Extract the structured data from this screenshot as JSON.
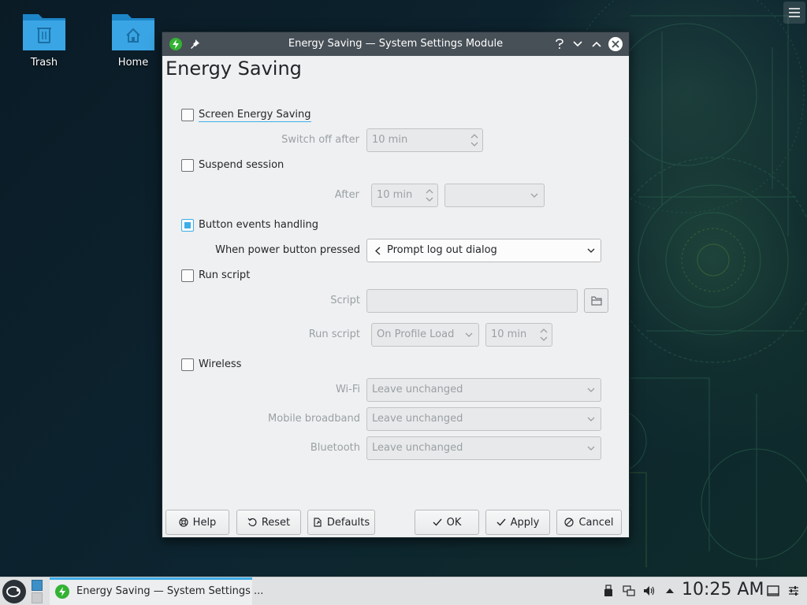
{
  "desktop": {
    "icons": [
      {
        "label": "Trash",
        "icon": "trash-folder-icon"
      },
      {
        "label": "Home",
        "icon": "home-folder-icon"
      }
    ]
  },
  "window": {
    "title": "Energy Saving — System Settings Module",
    "page_title": "Energy Saving",
    "screen_energy": {
      "label": "Screen Energy Saving",
      "checked": false,
      "switch_off_label": "Switch off after",
      "switch_off_value": "10 min"
    },
    "suspend": {
      "label": "Suspend session",
      "checked": false,
      "after_label": "After",
      "after_value": "10 min",
      "action_value": ""
    },
    "button_events": {
      "label": "Button events handling",
      "checked": true,
      "power_label": "When power button pressed",
      "power_value": "Prompt log out dialog"
    },
    "run_script": {
      "label": "Run script",
      "checked": false,
      "script_label": "Script",
      "script_value": "",
      "run_label": "Run script",
      "run_value": "On Profile Load",
      "time_value": "10 min"
    },
    "wireless": {
      "label": "Wireless",
      "checked": false,
      "wifi_label": "Wi-Fi",
      "wifi_value": "Leave unchanged",
      "mobile_label": "Mobile broadband",
      "mobile_value": "Leave unchanged",
      "bluetooth_label": "Bluetooth",
      "bluetooth_value": "Leave unchanged"
    },
    "buttons": {
      "help": "Help",
      "reset": "Reset",
      "defaults": "Defaults",
      "ok": "OK",
      "apply": "Apply",
      "cancel": "Cancel"
    }
  },
  "taskbar": {
    "task_label": "Energy Saving — System Settings ...",
    "clock": "10:25 AM"
  },
  "colors": {
    "accent": "#3daee9",
    "titlebar": "#475057",
    "window_bg": "#eff0f1",
    "app_green": "#33b233"
  }
}
